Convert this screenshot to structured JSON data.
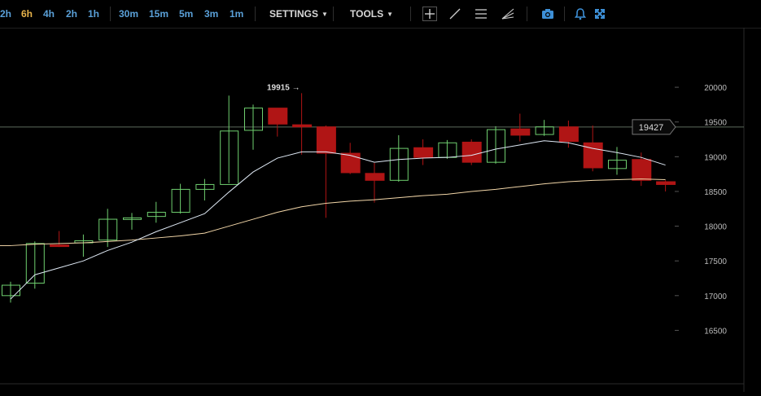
{
  "toolbar": {
    "timeframes_hours": [
      {
        "label": "2h",
        "active": false
      },
      {
        "label": "6h",
        "active": true
      },
      {
        "label": "4h",
        "active": false
      },
      {
        "label": "2h",
        "active": false
      },
      {
        "label": "1h",
        "active": false
      }
    ],
    "timeframes_minutes": [
      {
        "label": "30m",
        "active": false
      },
      {
        "label": "15m",
        "active": false
      },
      {
        "label": "5m",
        "active": false
      },
      {
        "label": "3m",
        "active": false
      },
      {
        "label": "1m",
        "active": false
      }
    ],
    "settings_label": "SETTINGS",
    "tools_label": "TOOLS",
    "icons": [
      "crosshair-icon",
      "trendline-icon",
      "horizontal-lines-icon",
      "fan-icon",
      "camera-icon",
      "bell-icon",
      "fullscreen-icon"
    ]
  },
  "colors": {
    "up_candle": "#6fcf6f",
    "down_candle": "#b01515",
    "ma_fast": "#dfe9f5",
    "ma_slow": "#f2d6a8",
    "timeframe": "#5aa0d8",
    "timeframe_active": "#e6b24a"
  },
  "chart_data": {
    "type": "candlestick",
    "ylim": [
      16200,
      20400
    ],
    "yticks": [
      16500,
      17000,
      17500,
      18000,
      18500,
      19000,
      19500,
      20000
    ],
    "price_line": 19427,
    "price_label": "19427",
    "high_annotation": {
      "label": "19915",
      "value": 19915,
      "candle_index": 12
    },
    "candles": [
      {
        "o": 17000,
        "h": 17200,
        "l": 16900,
        "c": 17150
      },
      {
        "o": 17180,
        "h": 17780,
        "l": 17100,
        "c": 17750
      },
      {
        "o": 17730,
        "h": 17930,
        "l": 17700,
        "c": 17720
      },
      {
        "o": 17760,
        "h": 17880,
        "l": 17560,
        "c": 17790
      },
      {
        "o": 17800,
        "h": 18250,
        "l": 17700,
        "c": 18100
      },
      {
        "o": 18100,
        "h": 18190,
        "l": 17950,
        "c": 18120
      },
      {
        "o": 18140,
        "h": 18350,
        "l": 18050,
        "c": 18200
      },
      {
        "o": 18200,
        "h": 18610,
        "l": 18180,
        "c": 18530
      },
      {
        "o": 18530,
        "h": 18680,
        "l": 18370,
        "c": 18600
      },
      {
        "o": 18600,
        "h": 19880,
        "l": 18620,
        "c": 19370
      },
      {
        "o": 19380,
        "h": 19750,
        "l": 19100,
        "c": 19700
      },
      {
        "o": 19700,
        "h": 19700,
        "l": 19290,
        "c": 19470
      },
      {
        "o": 19460,
        "h": 19915,
        "l": 19030,
        "c": 19430
      },
      {
        "o": 19430,
        "h": 19450,
        "l": 18120,
        "c": 19050
      },
      {
        "o": 19050,
        "h": 19200,
        "l": 18750,
        "c": 18770
      },
      {
        "o": 18760,
        "h": 18910,
        "l": 18340,
        "c": 18660
      },
      {
        "o": 18660,
        "h": 19310,
        "l": 18640,
        "c": 19120
      },
      {
        "o": 19130,
        "h": 19250,
        "l": 18880,
        "c": 18990
      },
      {
        "o": 18990,
        "h": 19240,
        "l": 18970,
        "c": 19200
      },
      {
        "o": 19210,
        "h": 19250,
        "l": 18880,
        "c": 18920
      },
      {
        "o": 18920,
        "h": 19440,
        "l": 18900,
        "c": 19390
      },
      {
        "o": 19400,
        "h": 19620,
        "l": 19220,
        "c": 19310
      },
      {
        "o": 19320,
        "h": 19530,
        "l": 19300,
        "c": 19430
      },
      {
        "o": 19430,
        "h": 19520,
        "l": 19130,
        "c": 19220
      },
      {
        "o": 19200,
        "h": 19450,
        "l": 18790,
        "c": 18840
      },
      {
        "o": 18830,
        "h": 19140,
        "l": 18740,
        "c": 18950
      },
      {
        "o": 18960,
        "h": 19060,
        "l": 18580,
        "c": 18660
      },
      {
        "o": 18640,
        "h": 18660,
        "l": 18500,
        "c": 18600
      }
    ],
    "ma_fast": [
      16950,
      17300,
      17400,
      17500,
      17650,
      17770,
      17920,
      18050,
      18180,
      18490,
      18780,
      18980,
      19070,
      19070,
      19020,
      18920,
      18960,
      18980,
      18990,
      19020,
      19110,
      19170,
      19230,
      19200,
      19120,
      19060,
      18990,
      18880
    ],
    "ma_slow": [
      17720,
      17740,
      17750,
      17760,
      17780,
      17800,
      17830,
      17860,
      17900,
      18000,
      18100,
      18200,
      18280,
      18330,
      18360,
      18380,
      18410,
      18440,
      18460,
      18500,
      18530,
      18570,
      18610,
      18640,
      18660,
      18670,
      18680,
      18670
    ]
  }
}
